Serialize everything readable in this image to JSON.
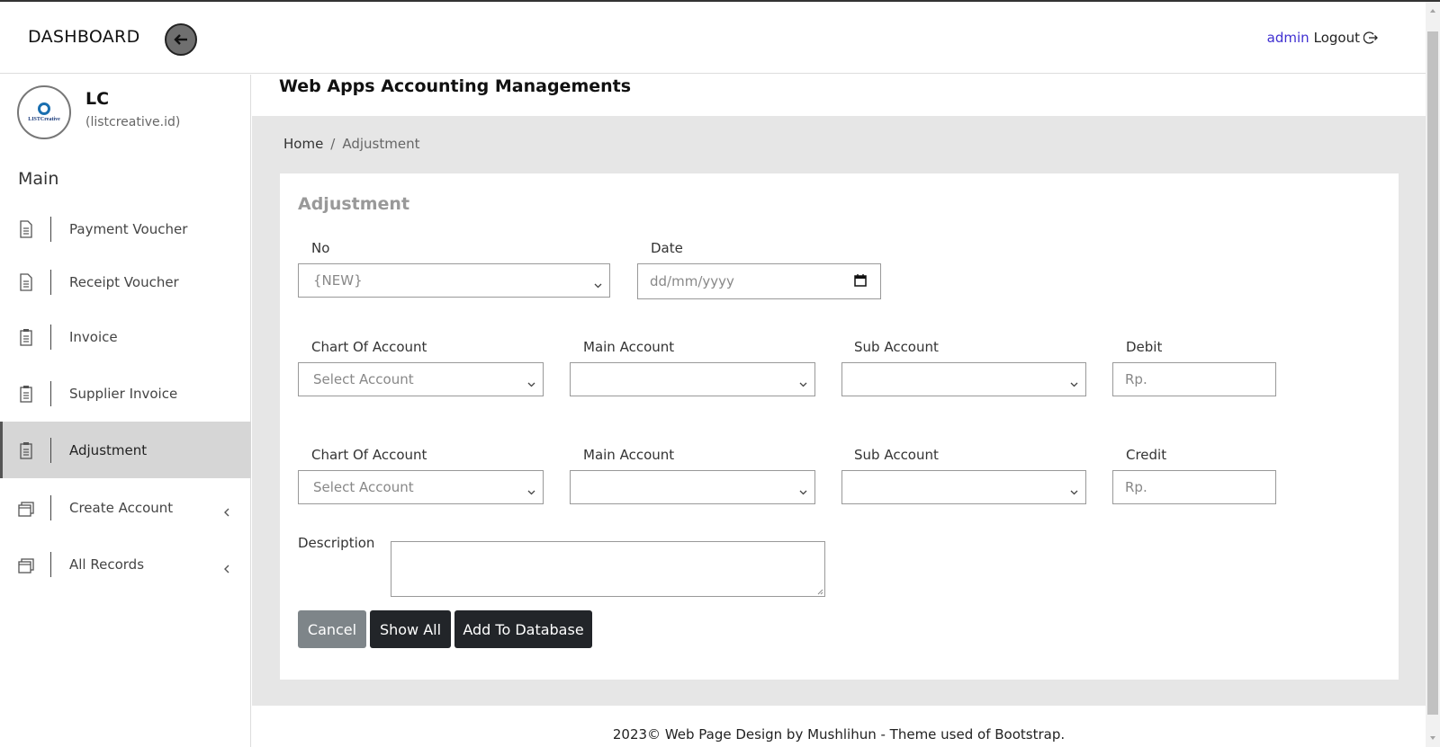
{
  "header": {
    "brand": "DASHBOARD",
    "user": "admin",
    "logout": "Logout"
  },
  "sidebar": {
    "profile_name": "LC",
    "profile_sub": "(listcreative.id)",
    "logo_text": "LISTCreative",
    "section": "Main",
    "items": [
      {
        "label": "Payment Voucher",
        "icon": "document-icon"
      },
      {
        "label": "Receipt Voucher",
        "icon": "document-icon"
      },
      {
        "label": "Invoice",
        "icon": "clipboard-icon"
      },
      {
        "label": "Supplier Invoice",
        "icon": "clipboard-icon"
      },
      {
        "label": "Adjustment",
        "icon": "clipboard-icon",
        "active": true
      },
      {
        "label": "Create Account",
        "icon": "window-icon",
        "expandable": true
      },
      {
        "label": "All Records",
        "icon": "window-icon",
        "expandable": true
      }
    ]
  },
  "main": {
    "title": "Web Apps Accounting Managements",
    "breadcrumb": {
      "home": "Home",
      "sep": "/",
      "current": "Adjustment"
    },
    "card_title": "Adjustment",
    "form": {
      "no_label": "No",
      "no_value": "{NEW}",
      "date_label": "Date",
      "date_placeholder": "dd/mm/yyyy",
      "debit_row": {
        "coa_label": "Chart Of Account",
        "coa_value": "Select Account",
        "main_label": "Main Account",
        "main_value": "",
        "sub_label": "Sub Account",
        "sub_value": "",
        "amount_label": "Debit",
        "amount_placeholder": "Rp."
      },
      "credit_row": {
        "coa_label": "Chart Of Account",
        "coa_value": "Select Account",
        "main_label": "Main Account",
        "main_value": "",
        "sub_label": "Sub Account",
        "sub_value": "",
        "amount_label": "Credit",
        "amount_placeholder": "Rp."
      },
      "description_label": "Description",
      "buttons": {
        "cancel": "Cancel",
        "show_all": "Show All",
        "add": "Add To Database"
      }
    },
    "footer": "2023© Web Page Design by Mushlihun - Theme used of Bootstrap."
  },
  "colors": {
    "accent_user": "#3f2fd1",
    "button_dark": "#222529",
    "button_cancel": "#7e8589",
    "main_bg": "#e6e6e6"
  }
}
